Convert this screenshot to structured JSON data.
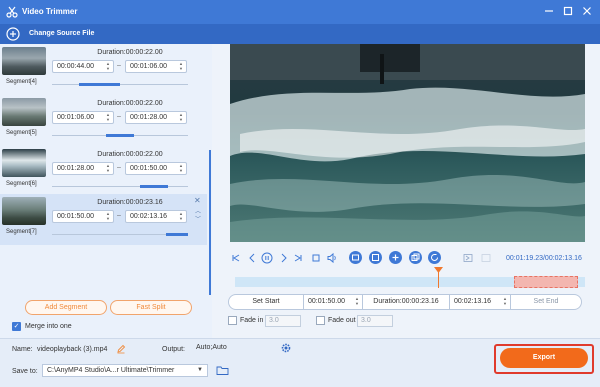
{
  "window": {
    "title": "Video Trimmer"
  },
  "toolbar": {
    "change_source": "Change Source File"
  },
  "segments": [
    {
      "label": "Segment[4]",
      "duration": "Duration:00:00:22.00",
      "start": "00:00:44.00",
      "end": "00:01:06.00",
      "fill": [
        0.2,
        0.5
      ]
    },
    {
      "label": "Segment[5]",
      "duration": "Duration:00:00:22.00",
      "start": "00:01:06.00",
      "end": "00:01:28.00",
      "fill": [
        0.4,
        0.6
      ]
    },
    {
      "label": "Segment[6]",
      "duration": "Duration:00:00:22.00",
      "start": "00:01:28.00",
      "end": "00:01:50.00",
      "fill": [
        0.65,
        0.85
      ]
    },
    {
      "label": "Segment[7]",
      "duration": "Duration:00:00:23.16",
      "start": "00:01:50.00",
      "end": "00:02:13.16",
      "fill": [
        0.84,
        1.0
      ]
    }
  ],
  "actions": {
    "add_segment": "Add Segment",
    "fast_split": "Fast Split",
    "merge_label": "Merge into one",
    "merge_checked": true
  },
  "player": {
    "timecode": "00:01:19.23/00:02:13.16"
  },
  "trim": {
    "set_start": "Set Start",
    "start_value": "00:01:50.00",
    "duration": "Duration:00:00:23.16",
    "end_value": "00:02:13.16",
    "set_end": "Set End",
    "fade_in": "Fade in",
    "fade_in_value": "3.0",
    "fade_out": "Fade out",
    "fade_out_value": "3.0"
  },
  "output": {
    "name_label": "Name:",
    "name_value": "videoplayback (3).mp4",
    "output_label": "Output:",
    "output_value": "Auto;Auto",
    "save_label": "Save to:",
    "save_value": "C:\\AnyMP4 Studio\\A...r Ultimate\\Trimmer",
    "export": "Export"
  },
  "colors": {
    "accent": "#3f79d6",
    "export": "#f26a1b",
    "highlight": "#e03a2c"
  }
}
